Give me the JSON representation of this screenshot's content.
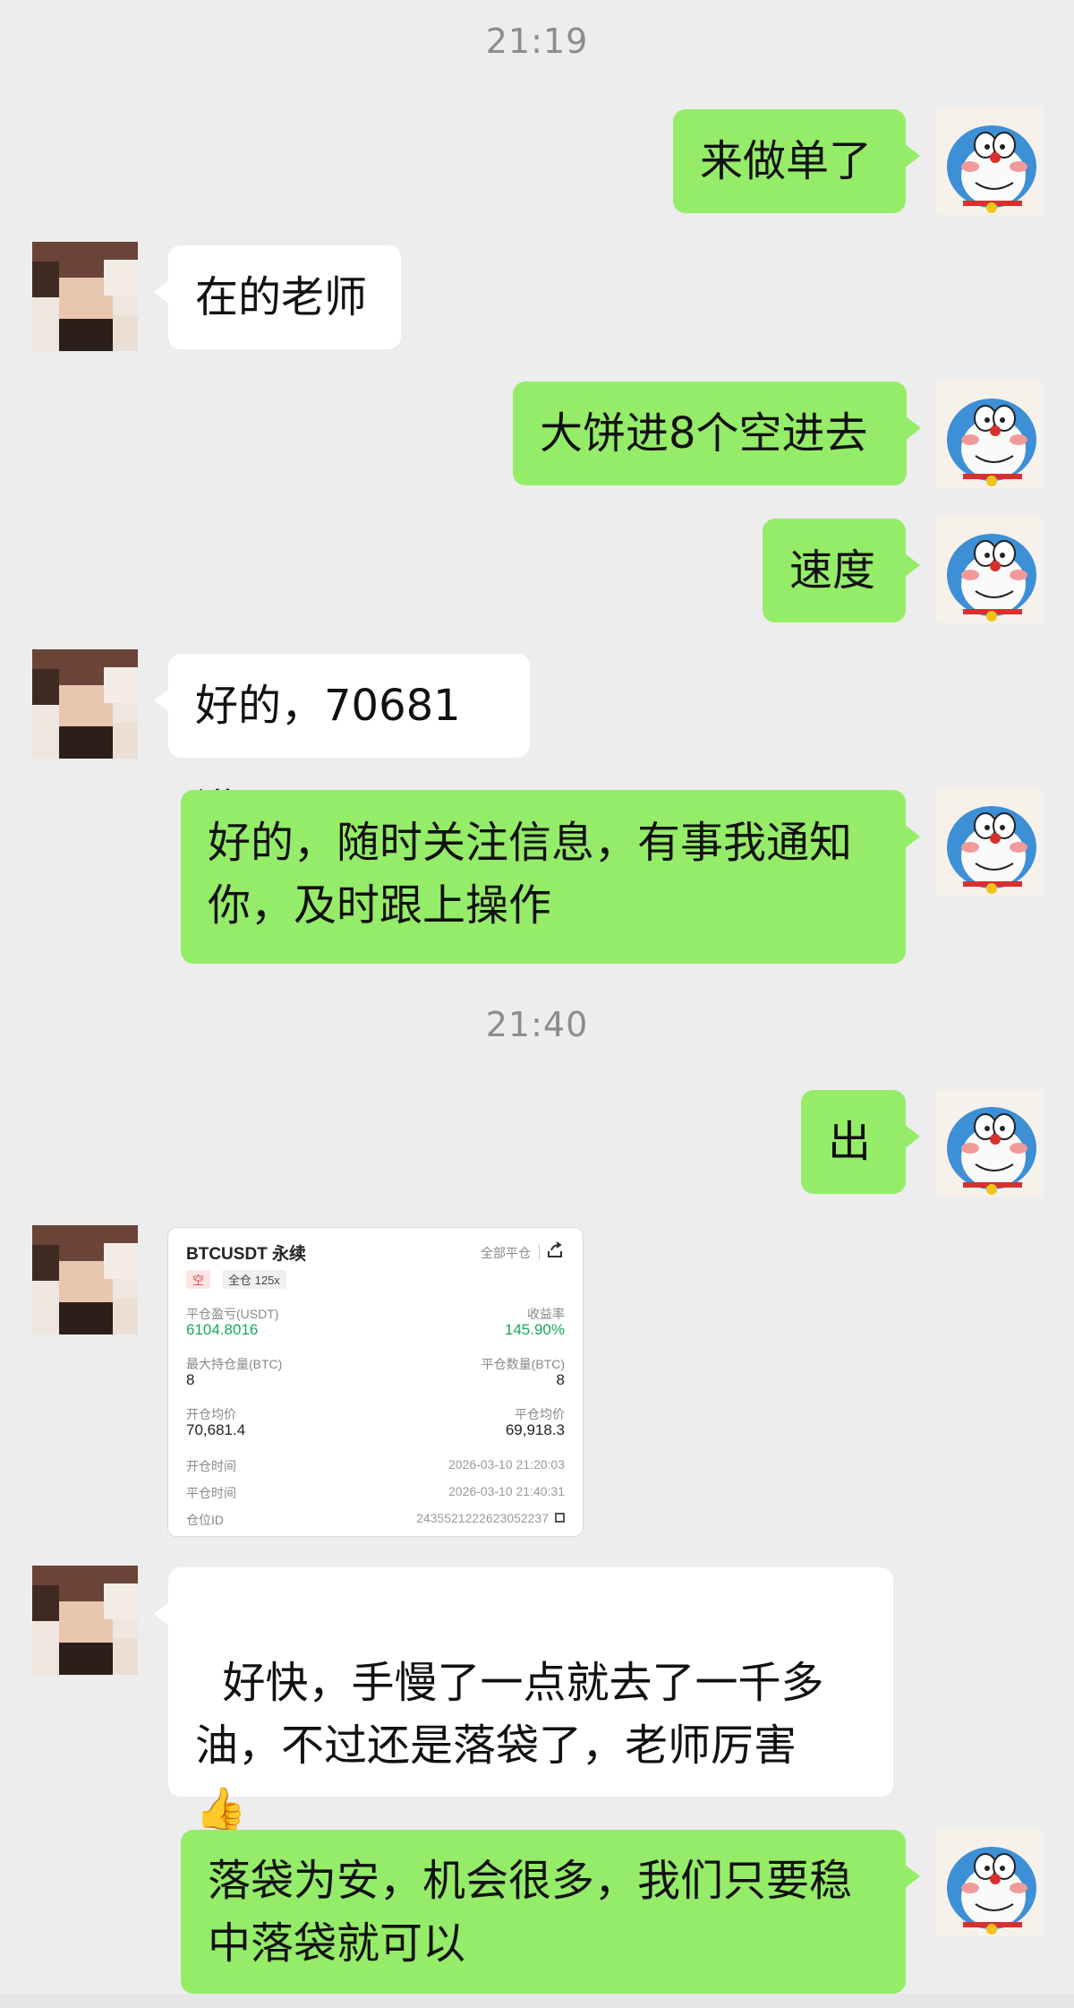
{
  "timestamps": [
    "21:19",
    "21:40"
  ],
  "messages": [
    {
      "text": "来做单了"
    },
    {
      "text": "在的老师"
    },
    {
      "text": "大饼进8个空进去"
    },
    {
      "text": "速度"
    },
    {
      "text": "好的，70681进"
    },
    {
      "text": "好的，随时关注信息，有事我通知\n你，及时跟上操作"
    },
    {
      "text": "出"
    },
    {
      "text": "好快，手慢了一点就去了一千多\n油，不过还是落袋了，老师厉害\n"
    },
    {
      "text": "落袋为安，机会很多，我们只要稳\n中落袋就可以"
    }
  ],
  "trade_card": {
    "title": "BTCUSDT 永续",
    "close_all": "全部平仓",
    "side_tag": "空",
    "margin_tag": "全仓 125x",
    "pnl_label": "平仓盈亏(USDT)",
    "pnl_value": "6104.8016",
    "roi_label": "收益率",
    "roi_value": "145.90%",
    "max_pos_label": "最大持仓量(BTC)",
    "max_pos_value": "8",
    "close_qty_label": "平仓数量(BTC)",
    "close_qty_value": "8",
    "open_avg_label": "开仓均价",
    "open_avg_value": "70,681.4",
    "close_avg_label": "平仓均价",
    "close_avg_value": "69,918.3",
    "open_time_label": "开仓时间",
    "open_time_value": "2026-03-10 21:20:03",
    "close_time_label": "平仓时间",
    "close_time_value": "2026-03-10 21:40:31",
    "position_id_label": "仓位ID",
    "position_id_value": "2435521222623052237"
  },
  "emoji": {
    "thumbs_up": "👍"
  },
  "colors": {
    "my_bubble": "#95ec69",
    "other_bubble": "#ffffff",
    "background": "#ededed",
    "profit_green": "#1aa65a"
  }
}
